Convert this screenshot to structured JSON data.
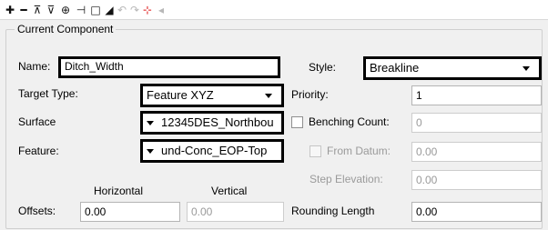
{
  "toolbar": {
    "icons": [
      {
        "name": "add-icon",
        "glyph": "✚",
        "enabled": true
      },
      {
        "name": "remove-icon",
        "glyph": "━",
        "enabled": true
      },
      {
        "name": "insert-above-icon",
        "glyph": "⊼",
        "enabled": true
      },
      {
        "name": "insert-below-icon",
        "glyph": "⊽",
        "enabled": true
      },
      {
        "name": "split-icon",
        "glyph": "⊕",
        "enabled": true
      },
      {
        "name": "join-icon",
        "glyph": "⊣",
        "enabled": true
      },
      {
        "name": "close-shape-icon",
        "glyph": "□",
        "enabled": true
      },
      {
        "name": "mirror-icon",
        "glyph": "◢",
        "enabled": true
      },
      {
        "name": "undo-icon",
        "glyph": "↶",
        "enabled": false
      },
      {
        "name": "redo-icon",
        "glyph": "↷",
        "enabled": false
      },
      {
        "name": "point-icon",
        "glyph": "⊹",
        "enabled": true
      },
      {
        "name": "collapse-icon",
        "glyph": "◂",
        "enabled": false
      }
    ]
  },
  "group": {
    "title": "Current Component"
  },
  "name": {
    "label": "Name:",
    "value": "Ditch_Width"
  },
  "style": {
    "label": "Style:",
    "value": "Breakline"
  },
  "target_type": {
    "label": "Target Type:",
    "value": "Feature XYZ"
  },
  "priority": {
    "label": "Priority:",
    "value": "1"
  },
  "surface": {
    "label": "Surface",
    "value": "12345DES_Northbou"
  },
  "benching_count": {
    "label": "Benching Count:",
    "value": "0",
    "checked": false
  },
  "feature": {
    "label": "Feature:",
    "value": "und-Conc_EOP-Top"
  },
  "from_datum": {
    "label": "From Datum:",
    "value": "0.00",
    "checked": false
  },
  "step_elevation": {
    "label": "Step Elevation:",
    "value": "0.00"
  },
  "offsets": {
    "horizontal_header": "Horizontal",
    "vertical_header": "Vertical",
    "label": "Offsets:",
    "horizontal_value": "0.00",
    "vertical_value": "0.00"
  },
  "rounding_length": {
    "label": "Rounding Length",
    "value": "0.00"
  }
}
